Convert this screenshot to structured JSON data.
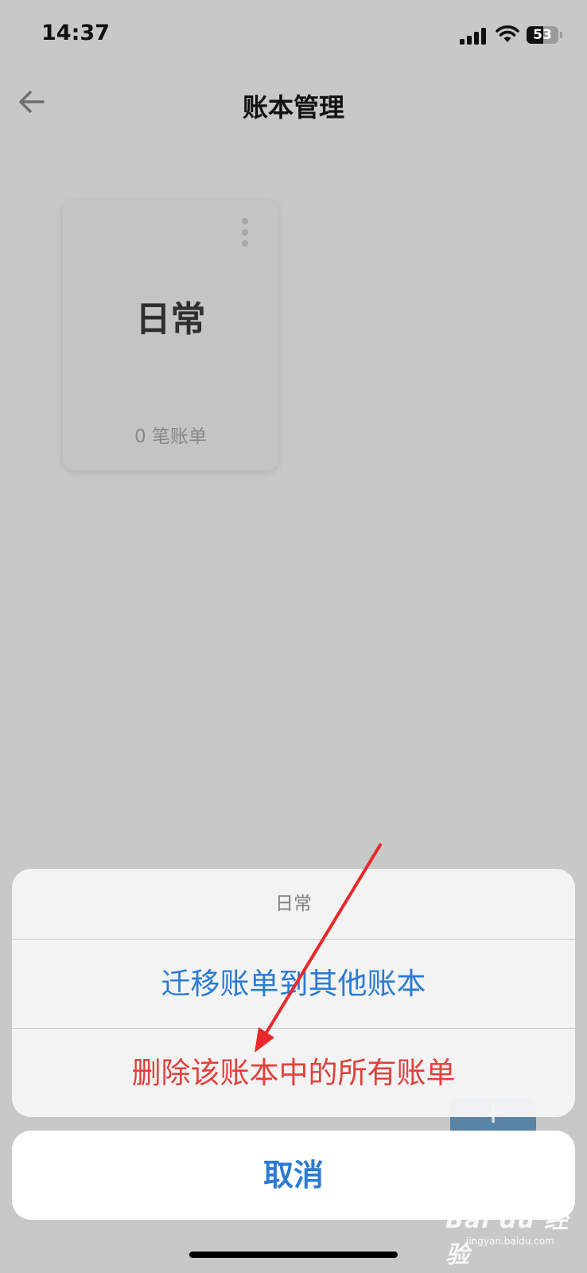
{
  "status_bar": {
    "time": "14:37",
    "battery": "53",
    "battery_level": 0.53,
    "icons": [
      "signal-icon",
      "wifi-icon",
      "battery-icon"
    ]
  },
  "nav": {
    "title": "账本管理",
    "back_icon": "arrow-left-icon"
  },
  "book_card": {
    "name": "日常",
    "count": "0 笔账单",
    "menu_icon": "more-vertical-icon"
  },
  "fab": {
    "label": "+",
    "color": "#5a84a6"
  },
  "action_sheet": {
    "title": "日常",
    "actions": [
      {
        "label": "迁移账单到其他账本",
        "color": "#2a7bd3"
      },
      {
        "label": "删除该账本中的所有账单",
        "color": "#e2403c"
      }
    ],
    "cancel": "取消"
  },
  "annotation": {
    "arrow_color": "#e8282a"
  },
  "watermark": {
    "brand": "Bai du 经验",
    "site": "jingyan.baidu.com"
  }
}
